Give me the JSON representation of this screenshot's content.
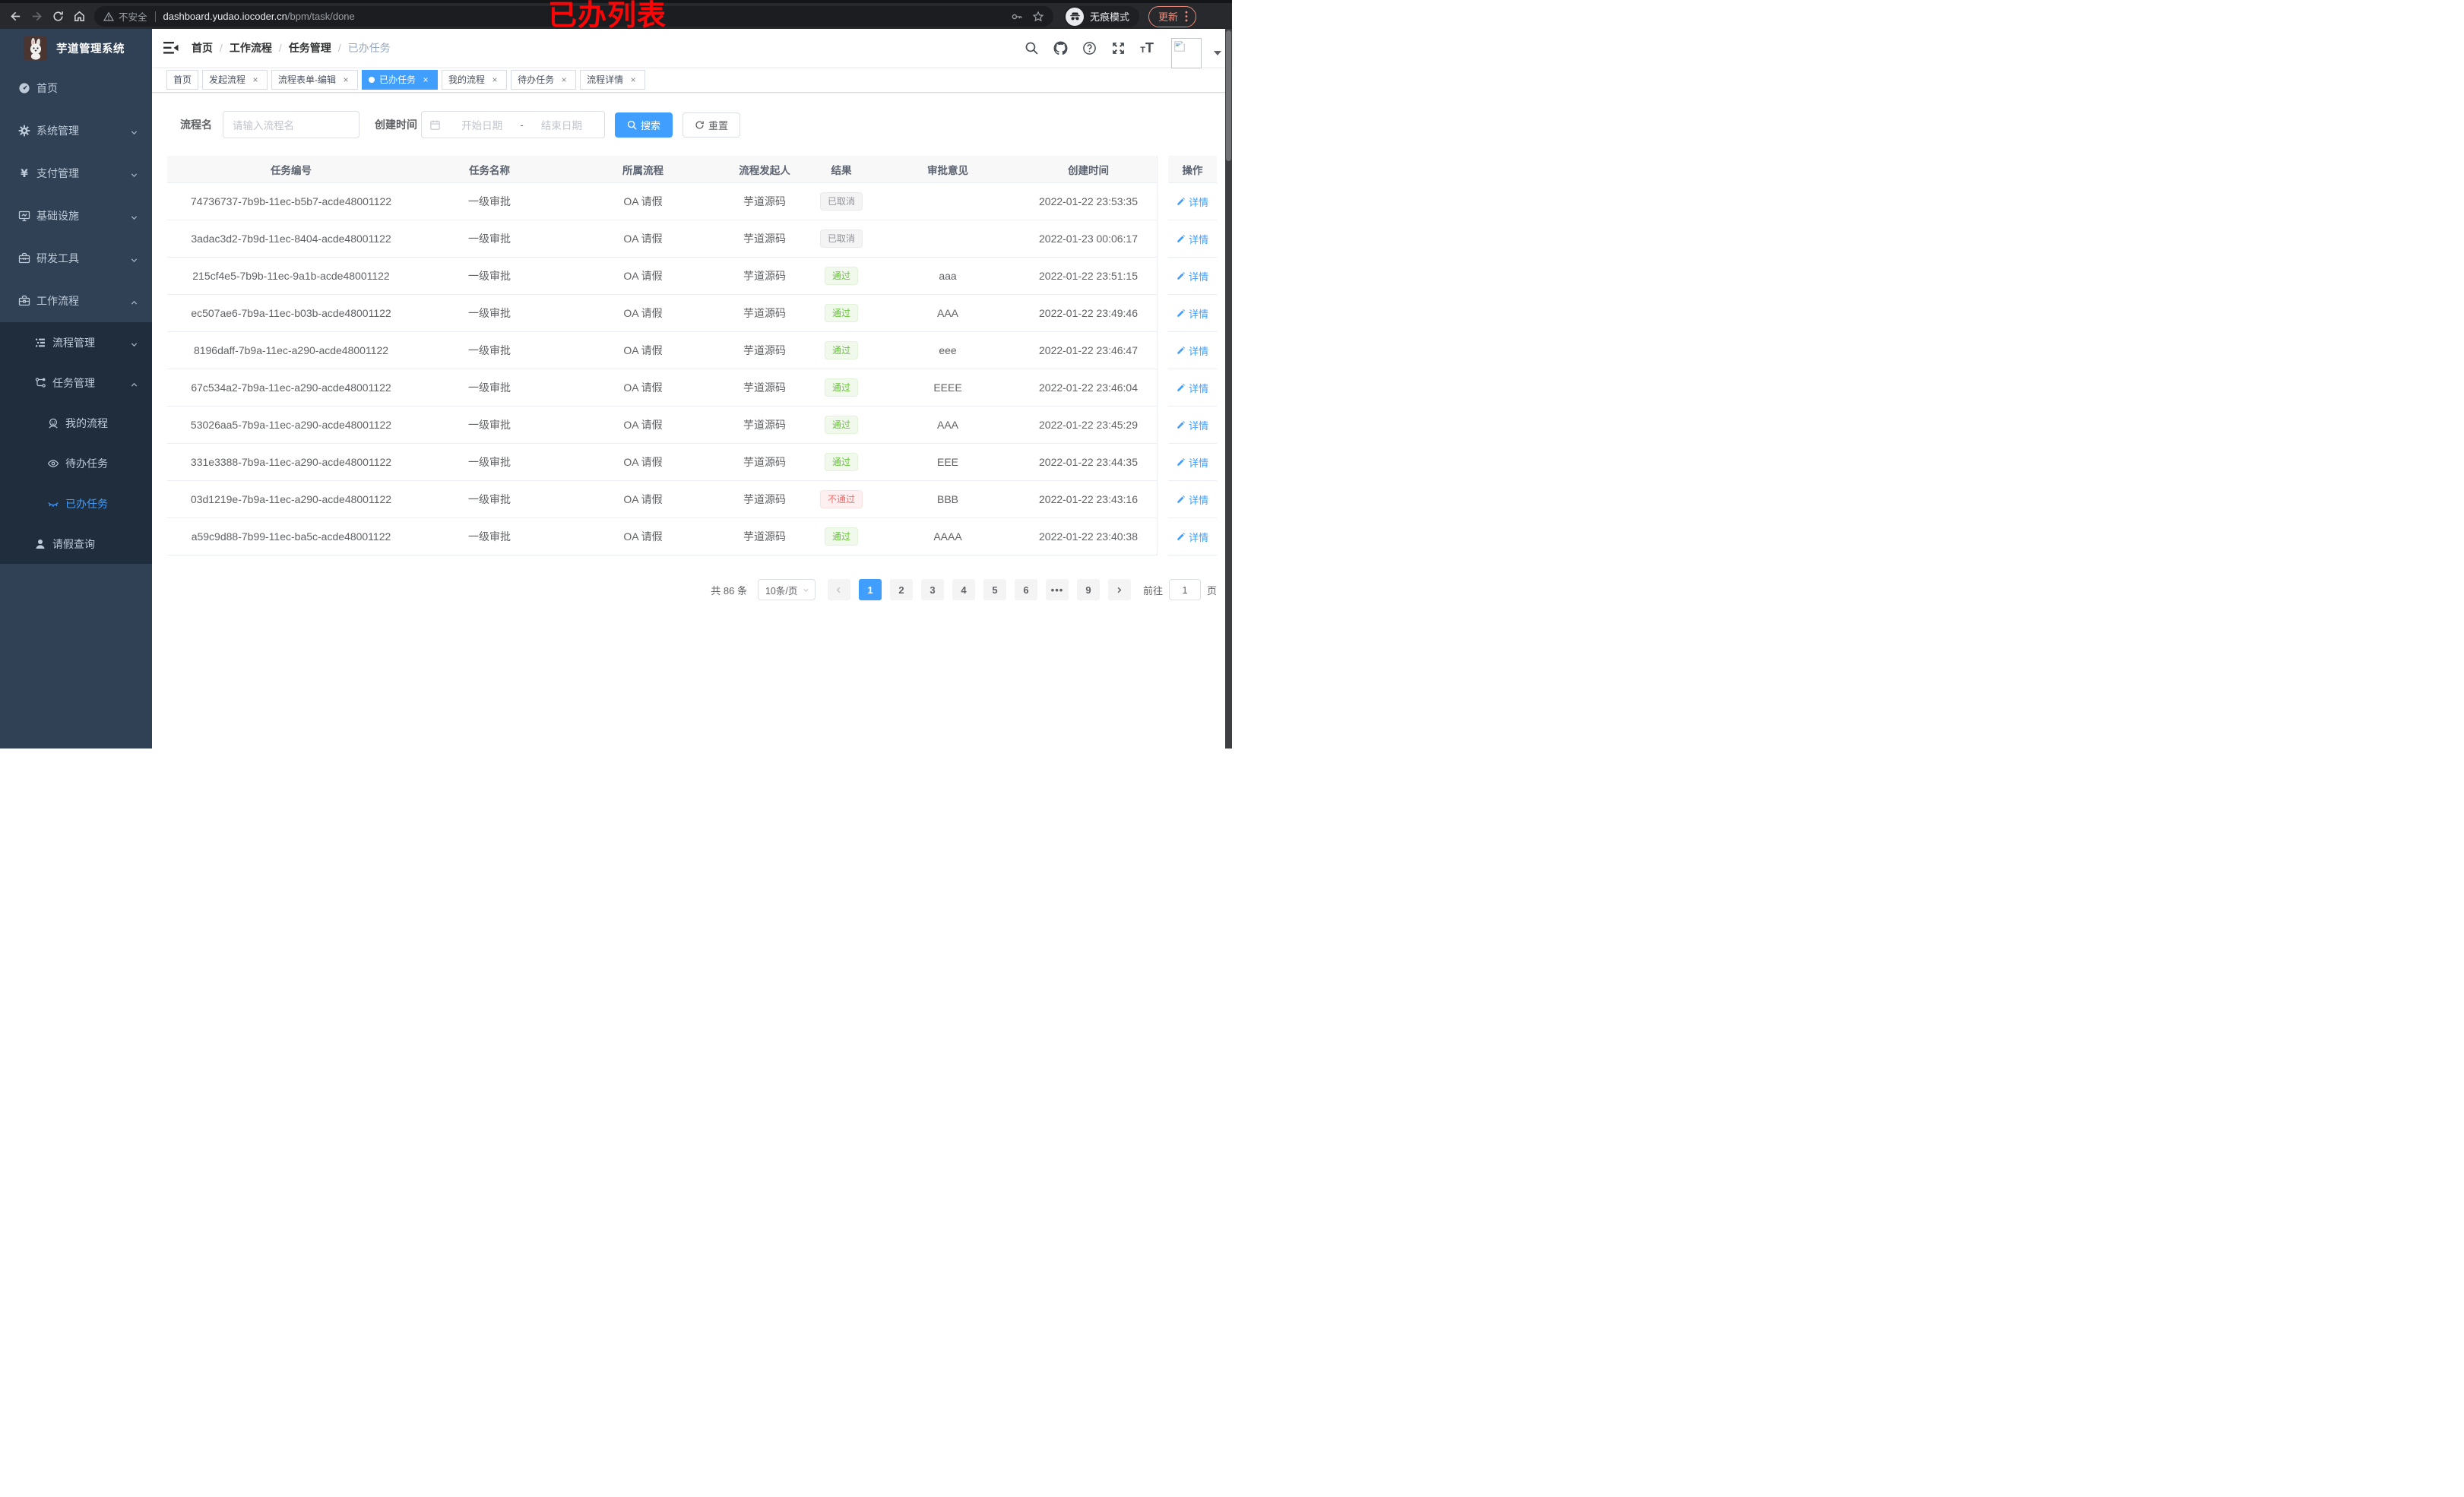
{
  "browser": {
    "insecure_label": "不安全",
    "url_host": "dashboard.yudao.iocoder.cn",
    "url_path": "/bpm/task/done",
    "incognito_label": "无痕模式",
    "update_label": "更新",
    "annotation": "已办列表"
  },
  "sidebar": {
    "title": "芋道管理系统",
    "items": [
      {
        "label": "首页",
        "icon": "dashboard-icon",
        "level": 1
      },
      {
        "label": "系统管理",
        "icon": "gear-icon",
        "level": 1,
        "chevron": "down"
      },
      {
        "label": "支付管理",
        "icon": "yen-icon",
        "level": 1,
        "chevron": "down"
      },
      {
        "label": "基础设施",
        "icon": "monitor-icon",
        "level": 1,
        "chevron": "down"
      },
      {
        "label": "研发工具",
        "icon": "toolbox-icon",
        "level": 1,
        "chevron": "down"
      },
      {
        "label": "工作流程",
        "icon": "briefcase-icon",
        "level": 1,
        "chevron": "up"
      },
      {
        "label": "流程管理",
        "icon": "tree-icon",
        "level": 2,
        "chevron": "down",
        "sub": true
      },
      {
        "label": "任务管理",
        "icon": "flow-icon",
        "level": 2,
        "chevron": "up",
        "sub": true
      },
      {
        "label": "我的流程",
        "icon": "face-icon",
        "level": 3,
        "sub": true
      },
      {
        "label": "待办任务",
        "icon": "eye-open-icon",
        "level": 3,
        "sub": true
      },
      {
        "label": "已办任务",
        "icon": "eye-closed-icon",
        "level": 3,
        "sub": true,
        "active": true
      },
      {
        "label": "请假查询",
        "icon": "user-icon",
        "level": 2,
        "sub": true
      }
    ]
  },
  "header": {
    "breadcrumb": [
      "首页",
      "工作流程",
      "任务管理",
      "已办任务"
    ]
  },
  "tabs": [
    {
      "label": "首页",
      "closable": false,
      "active": false
    },
    {
      "label": "发起流程",
      "closable": true,
      "active": false
    },
    {
      "label": "流程表单-编辑",
      "closable": true,
      "active": false
    },
    {
      "label": "已办任务",
      "closable": true,
      "active": true
    },
    {
      "label": "我的流程",
      "closable": true,
      "active": false
    },
    {
      "label": "待办任务",
      "closable": true,
      "active": false
    },
    {
      "label": "流程详情",
      "closable": true,
      "active": false
    }
  ],
  "filters": {
    "name_label": "流程名",
    "name_placeholder": "请输入流程名",
    "time_label": "创建时间",
    "start_placeholder": "开始日期",
    "range_separator": "-",
    "end_placeholder": "结束日期",
    "search_label": "搜索",
    "reset_label": "重置"
  },
  "table": {
    "columns": [
      "任务编号",
      "任务名称",
      "所属流程",
      "流程发起人",
      "结果",
      "审批意见",
      "创建时间",
      "操作"
    ],
    "action_label": "详情",
    "rows": [
      {
        "id": "74736737-7b9b-11ec-b5b7-acde48001122",
        "name": "一级审批",
        "process": "OA 请假",
        "starter": "芋道源码",
        "result": "已取消",
        "result_type": "info",
        "comment": "",
        "created": "2022-01-22 23:53:35"
      },
      {
        "id": "3adac3d2-7b9d-11ec-8404-acde48001122",
        "name": "一级审批",
        "process": "OA 请假",
        "starter": "芋道源码",
        "result": "已取消",
        "result_type": "info",
        "comment": "",
        "created": "2022-01-23 00:06:17"
      },
      {
        "id": "215cf4e5-7b9b-11ec-9a1b-acde48001122",
        "name": "一级审批",
        "process": "OA 请假",
        "starter": "芋道源码",
        "result": "通过",
        "result_type": "success",
        "comment": "aaa",
        "created": "2022-01-22 23:51:15"
      },
      {
        "id": "ec507ae6-7b9a-11ec-b03b-acde48001122",
        "name": "一级审批",
        "process": "OA 请假",
        "starter": "芋道源码",
        "result": "通过",
        "result_type": "success",
        "comment": "AAA",
        "created": "2022-01-22 23:49:46"
      },
      {
        "id": "8196daff-7b9a-11ec-a290-acde48001122",
        "name": "一级审批",
        "process": "OA 请假",
        "starter": "芋道源码",
        "result": "通过",
        "result_type": "success",
        "comment": "eee",
        "created": "2022-01-22 23:46:47"
      },
      {
        "id": "67c534a2-7b9a-11ec-a290-acde48001122",
        "name": "一级审批",
        "process": "OA 请假",
        "starter": "芋道源码",
        "result": "通过",
        "result_type": "success",
        "comment": "EEEE",
        "created": "2022-01-22 23:46:04"
      },
      {
        "id": "53026aa5-7b9a-11ec-a290-acde48001122",
        "name": "一级审批",
        "process": "OA 请假",
        "starter": "芋道源码",
        "result": "通过",
        "result_type": "success",
        "comment": "AAA",
        "created": "2022-01-22 23:45:29"
      },
      {
        "id": "331e3388-7b9a-11ec-a290-acde48001122",
        "name": "一级审批",
        "process": "OA 请假",
        "starter": "芋道源码",
        "result": "通过",
        "result_type": "success",
        "comment": "EEE",
        "created": "2022-01-22 23:44:35"
      },
      {
        "id": "03d1219e-7b9a-11ec-a290-acde48001122",
        "name": "一级审批",
        "process": "OA 请假",
        "starter": "芋道源码",
        "result": "不通过",
        "result_type": "danger",
        "comment": "BBB",
        "created": "2022-01-22 23:43:16"
      },
      {
        "id": "a59c9d88-7b99-11ec-ba5c-acde48001122",
        "name": "一级审批",
        "process": "OA 请假",
        "starter": "芋道源码",
        "result": "通过",
        "result_type": "success",
        "comment": "AAAA",
        "created": "2022-01-22 23:40:38"
      }
    ]
  },
  "pagination": {
    "total_label": "共 86 条",
    "page_size": "10条/页",
    "pages": [
      {
        "label": "1",
        "active": true
      },
      {
        "label": "2"
      },
      {
        "label": "3"
      },
      {
        "label": "4"
      },
      {
        "label": "5"
      },
      {
        "label": "6"
      },
      {
        "label": "•••",
        "more": true
      },
      {
        "label": "9"
      }
    ],
    "goto_label": "前往",
    "goto_value": "1",
    "page_unit": "页"
  },
  "colors": {
    "accent": "#409eff",
    "success": "#67c23a",
    "danger": "#f56c6c",
    "info": "#909399",
    "sidebar_bg": "#304156",
    "submenu_bg": "#1f2d3d",
    "annotation_red": "#fb0506"
  }
}
